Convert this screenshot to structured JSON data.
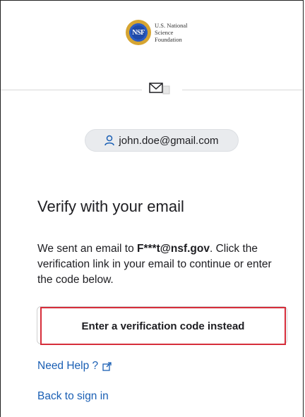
{
  "logo": {
    "seal_text": "NSF",
    "lines": [
      "U.S. National",
      "Science",
      "Foundation"
    ]
  },
  "icons": {
    "mail": "envelope-icon",
    "user": "user-icon",
    "external": "external-link-icon"
  },
  "user_identifier": "john.doe@gmail.com",
  "title": "Verify with your email",
  "message": {
    "before": "We sent an email to ",
    "masked_email": "F***t@nsf.gov",
    "after": ". Click the verification link in your email to continue or enter the code below."
  },
  "verification_button_label": "Enter a verification code instead",
  "links": {
    "help": "Need Help ?",
    "back": "Back to sign in"
  },
  "colors": {
    "link": "#1a5fb4",
    "highlight": "#d62d3a",
    "pill_bg": "#e9ebee"
  }
}
